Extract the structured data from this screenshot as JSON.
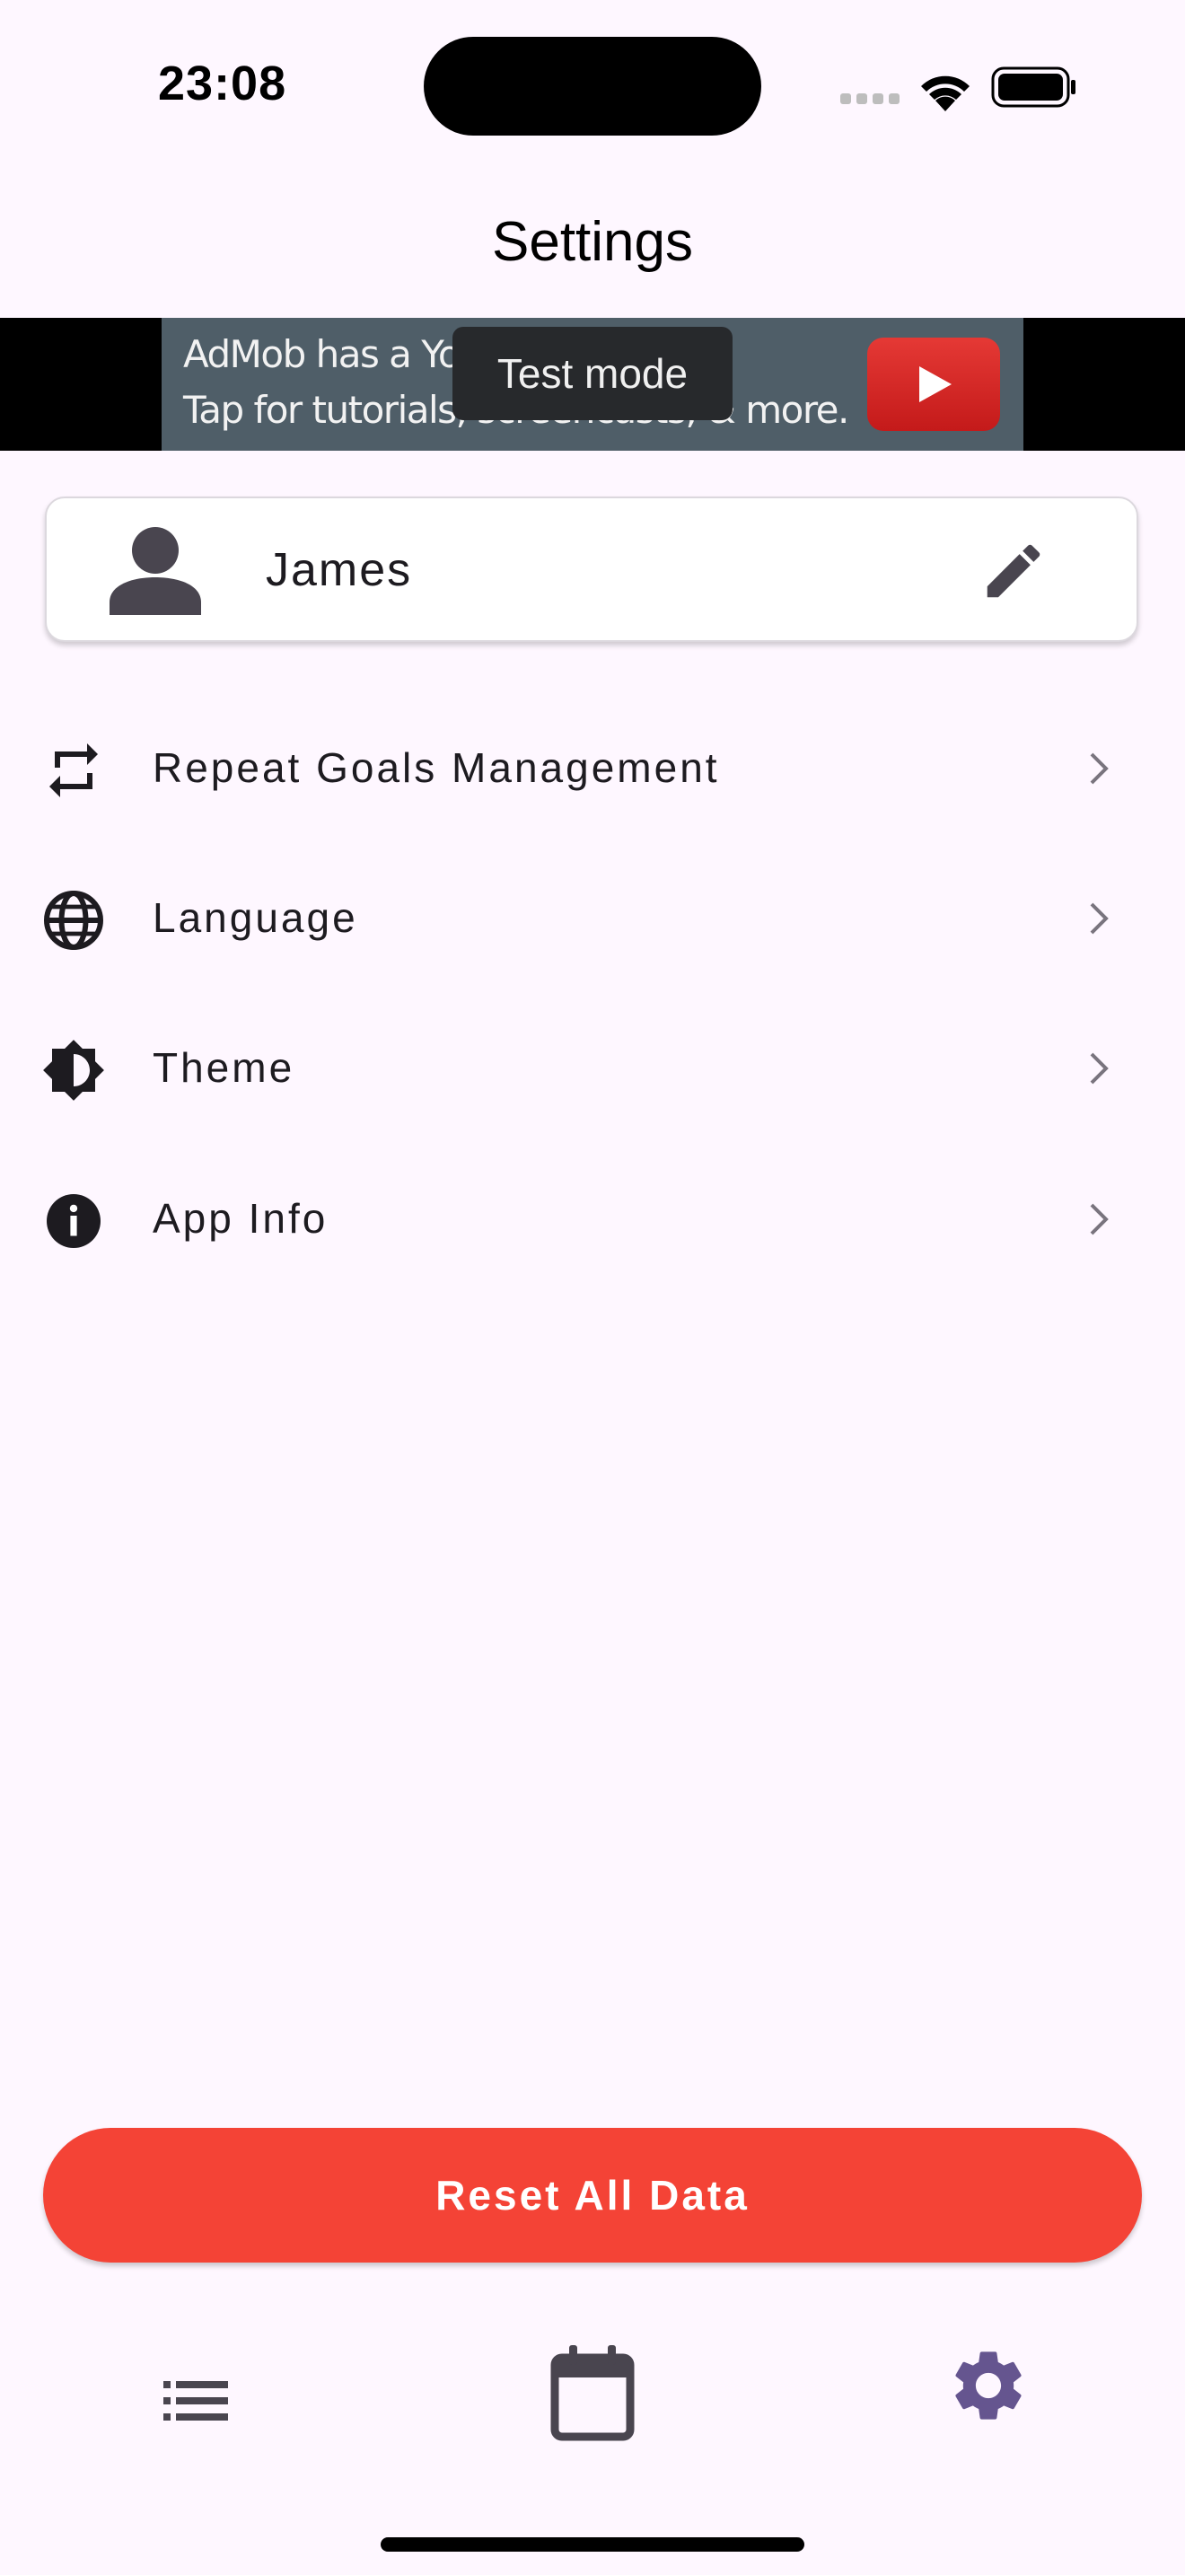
{
  "status_bar": {
    "time": "23:08"
  },
  "header": {
    "title": "Settings"
  },
  "ad_banner": {
    "line_1": "AdMob has a YouTube channel!",
    "line_2": "Tap for tutorials, screencasts, & more.",
    "badge": "Test mode"
  },
  "profile": {
    "name": "James"
  },
  "settings_items": [
    {
      "label": "Repeat Goals Management",
      "icon": "repeat-icon"
    },
    {
      "label": "Language",
      "icon": "globe-icon"
    },
    {
      "label": "Theme",
      "icon": "brightness-icon"
    },
    {
      "label": "App Info",
      "icon": "info-icon"
    }
  ],
  "reset_button": {
    "label": "Reset All Data"
  },
  "bottom_nav": {
    "items": [
      {
        "icon": "list-icon",
        "active": false
      },
      {
        "icon": "calendar-icon",
        "active": false
      },
      {
        "icon": "gear-icon",
        "active": true
      }
    ],
    "active_color": "#65558F",
    "inactive_color": "#49454F"
  },
  "colors": {
    "background": "#FEF7FF",
    "reset": "#F44336"
  }
}
